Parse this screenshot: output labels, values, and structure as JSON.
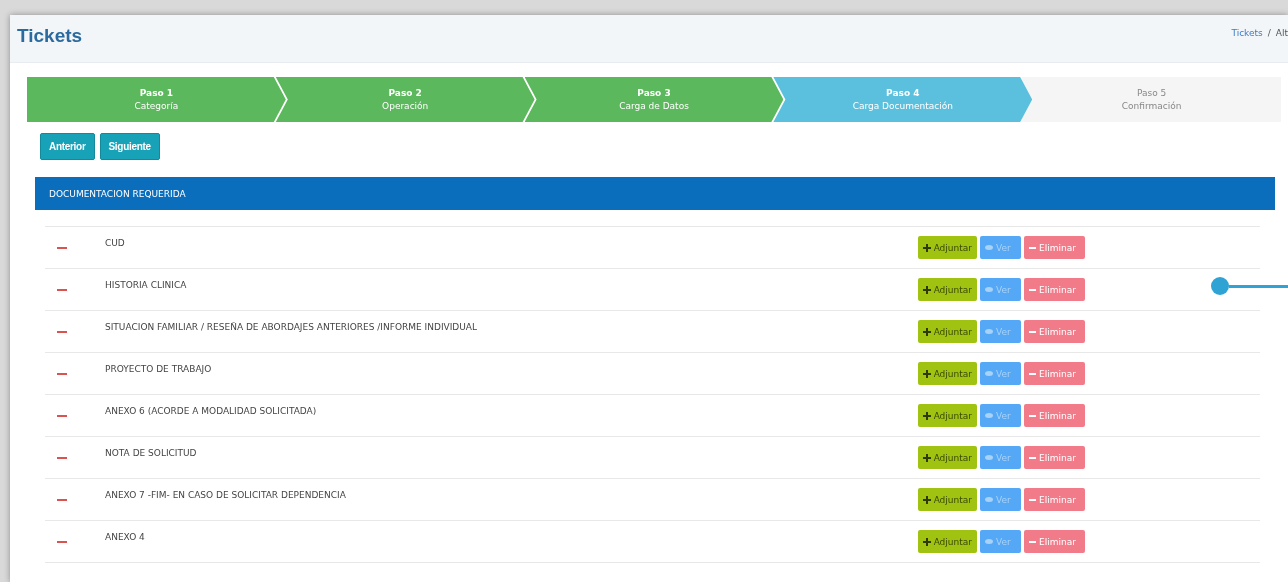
{
  "header": {
    "title": "Tickets",
    "breadcrumb": [
      {
        "label": "Tickets",
        "kind": "link"
      },
      {
        "label": "/",
        "kind": "text"
      },
      {
        "label": "Alt",
        "kind": "text"
      }
    ]
  },
  "wizard": {
    "steps": [
      {
        "number": "Paso 1",
        "label": "Categoría",
        "kind": "done"
      },
      {
        "number": "Paso 2",
        "label": "Operación",
        "kind": "done"
      },
      {
        "number": "Paso 3",
        "label": "Carga de Datos",
        "kind": "done"
      },
      {
        "number": "Paso 4",
        "label": "Carga Documentación",
        "kind": "active"
      },
      {
        "number": "Paso 5",
        "label": "Confirmación",
        "kind": "pending"
      }
    ]
  },
  "nav_buttons": [
    "Anterior",
    "Siguiente"
  ],
  "section": {
    "title": "DOCUMENTACION REQUERIDA"
  },
  "documents": [
    {
      "name": "CUD",
      "actions": [
        {
          "kind": "attach",
          "label": "Adjuntar",
          "disabled": false
        },
        {
          "kind": "view",
          "label": "Ver",
          "disabled": true
        },
        {
          "kind": "delete",
          "label": "Eliminar",
          "disabled": false
        }
      ]
    },
    {
      "name": "HISTORIA CLINICA",
      "actions": [
        {
          "kind": "attach",
          "label": "Adjuntar",
          "disabled": false
        },
        {
          "kind": "view",
          "label": "Ver",
          "disabled": true
        },
        {
          "kind": "delete",
          "label": "Eliminar",
          "disabled": false
        }
      ]
    },
    {
      "name": "SITUACION FAMILIAR / RESEÑA DE ABORDAJES ANTERIORES /INFORME INDIVIDUAL",
      "actions": [
        {
          "kind": "attach",
          "label": "Adjuntar",
          "disabled": false
        },
        {
          "kind": "view",
          "label": "Ver",
          "disabled": true
        },
        {
          "kind": "delete",
          "label": "Eliminar",
          "disabled": false
        }
      ]
    },
    {
      "name": "PROYECTO DE TRABAJO",
      "actions": [
        {
          "kind": "attach",
          "label": "Adjuntar",
          "disabled": false
        },
        {
          "kind": "view",
          "label": "Ver",
          "disabled": true
        },
        {
          "kind": "delete",
          "label": "Eliminar",
          "disabled": false
        }
      ]
    },
    {
      "name": "ANEXO 6 (ACORDE A MODALIDAD SOLICITADA)",
      "actions": [
        {
          "kind": "attach",
          "label": "Adjuntar",
          "disabled": false
        },
        {
          "kind": "view",
          "label": "Ver",
          "disabled": true
        },
        {
          "kind": "delete",
          "label": "Eliminar",
          "disabled": false
        }
      ]
    },
    {
      "name": "NOTA DE SOLICITUD",
      "actions": [
        {
          "kind": "attach",
          "label": "Adjuntar",
          "disabled": false
        },
        {
          "kind": "view",
          "label": "Ver",
          "disabled": true
        },
        {
          "kind": "delete",
          "label": "Eliminar",
          "disabled": false
        }
      ]
    },
    {
      "name": "ANEXO 7 -FIM- EN CASO DE SOLICITAR DEPENDENCIA",
      "actions": [
        {
          "kind": "attach",
          "label": "Adjuntar",
          "disabled": false
        },
        {
          "kind": "view",
          "label": "Ver",
          "disabled": true
        },
        {
          "kind": "delete",
          "label": "Eliminar",
          "disabled": false
        }
      ]
    },
    {
      "name": "ANEXO 4",
      "actions": [
        {
          "kind": "attach",
          "label": "Adjuntar",
          "disabled": false
        },
        {
          "kind": "view",
          "label": "Ver",
          "disabled": true
        },
        {
          "kind": "delete",
          "label": "Eliminar",
          "disabled": false
        }
      ]
    }
  ]
}
